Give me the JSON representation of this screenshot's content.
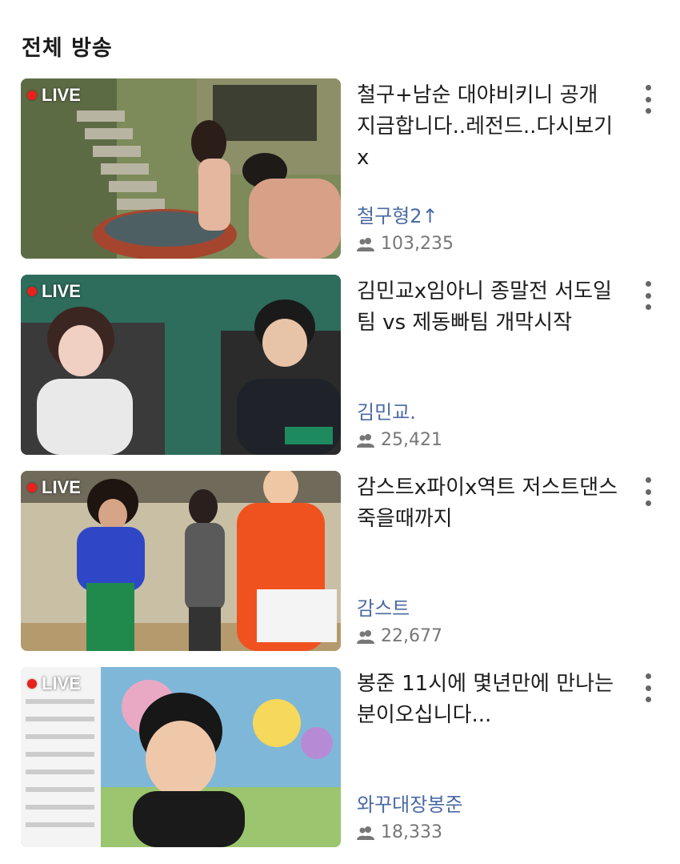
{
  "header": {
    "title": "전체 방송"
  },
  "live_badge": "LIVE",
  "broadcasts": [
    {
      "title": "철구+남순 대야비키니 공개 지금합니다..레전드..다시보기x",
      "channel": "철구형2↑",
      "views": "103,235"
    },
    {
      "title": "김민교x임아니 종말전 서도일팀 vs 제동빠팀 개막시작",
      "channel": "김민교.",
      "views": "25,421"
    },
    {
      "title": "감스트x파이x역트 저스트댄스 죽을때까지",
      "channel": "감스트",
      "views": "22,677"
    },
    {
      "title": "봉준 11시에 몇년만에 만나는 분이오십니다...",
      "channel": "와꾸대장봉준",
      "views": "18,333"
    }
  ],
  "icons": {
    "viewers": "viewers-icon",
    "more": "more-vertical-icon"
  },
  "colors": {
    "live_dot": "#e8221b",
    "channel": "#4b6aa3",
    "meta": "#777777"
  }
}
